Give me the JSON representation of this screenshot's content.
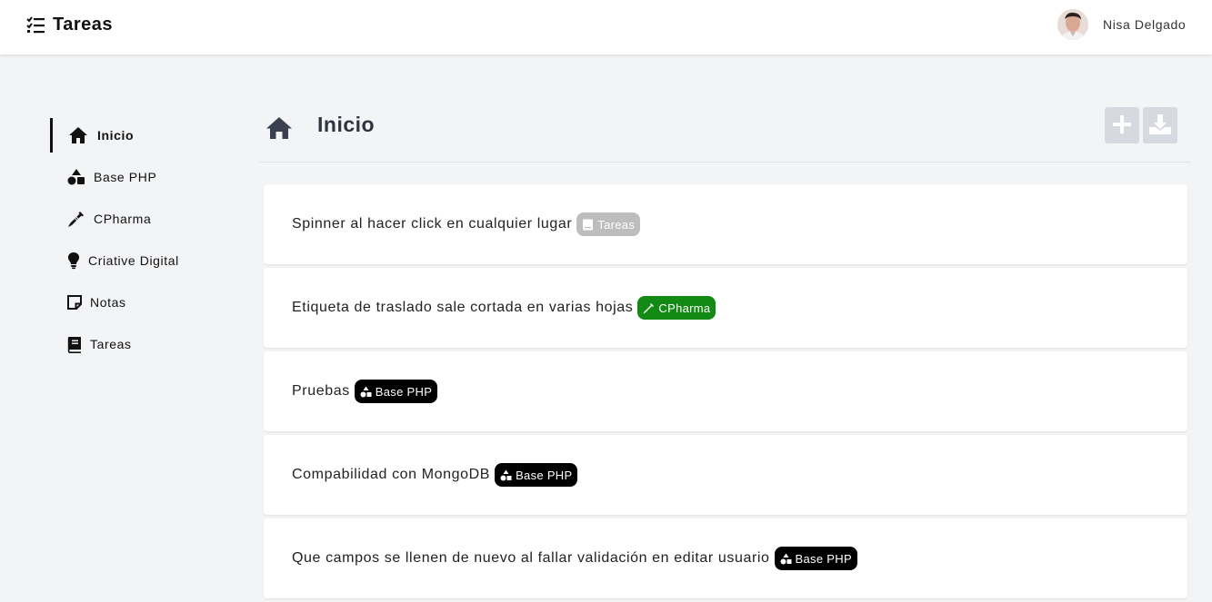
{
  "app": {
    "title": "Tareas"
  },
  "user": {
    "name": "Nisa Delgado"
  },
  "sidebar": {
    "items": [
      {
        "label": "Inicio",
        "icon": "home-icon",
        "active": true
      },
      {
        "label": "Base PHP",
        "icon": "shapes-icon"
      },
      {
        "label": "CPharma",
        "icon": "syringe-icon"
      },
      {
        "label": "Criative Digital",
        "icon": "lightbulb-icon"
      },
      {
        "label": "Notas",
        "icon": "note-icon"
      },
      {
        "label": "Tareas",
        "icon": "book-icon"
      }
    ]
  },
  "page": {
    "title": "Inicio",
    "actions": {
      "add": "plus-icon",
      "download": "download-icon"
    }
  },
  "tasks": [
    {
      "text": "Spinner al hacer click en cualquier lugar",
      "tag": {
        "label": "Tareas",
        "color": "#bdbdbd",
        "icon": "book-icon"
      }
    },
    {
      "text": "Etiqueta de traslado sale cortada en varias hojas",
      "tag": {
        "label": "CPharma",
        "color": "#138a13",
        "icon": "syringe-icon"
      }
    },
    {
      "text": "Pruebas",
      "tag": {
        "label": "Base PHP",
        "color": "#000000",
        "icon": "shapes-icon"
      }
    },
    {
      "text": "Compabilidad con MongoDB",
      "tag": {
        "label": "Base PHP",
        "color": "#000000",
        "icon": "shapes-icon"
      }
    },
    {
      "text": "Que campos se llenen de nuevo al fallar validación en editar usuario",
      "tag": {
        "label": "Base PHP",
        "color": "#000000",
        "icon": "shapes-icon"
      }
    }
  ],
  "colors": {
    "accent": "#111111",
    "page_title": "#2e3440",
    "button_bg": "#d6d9df"
  }
}
